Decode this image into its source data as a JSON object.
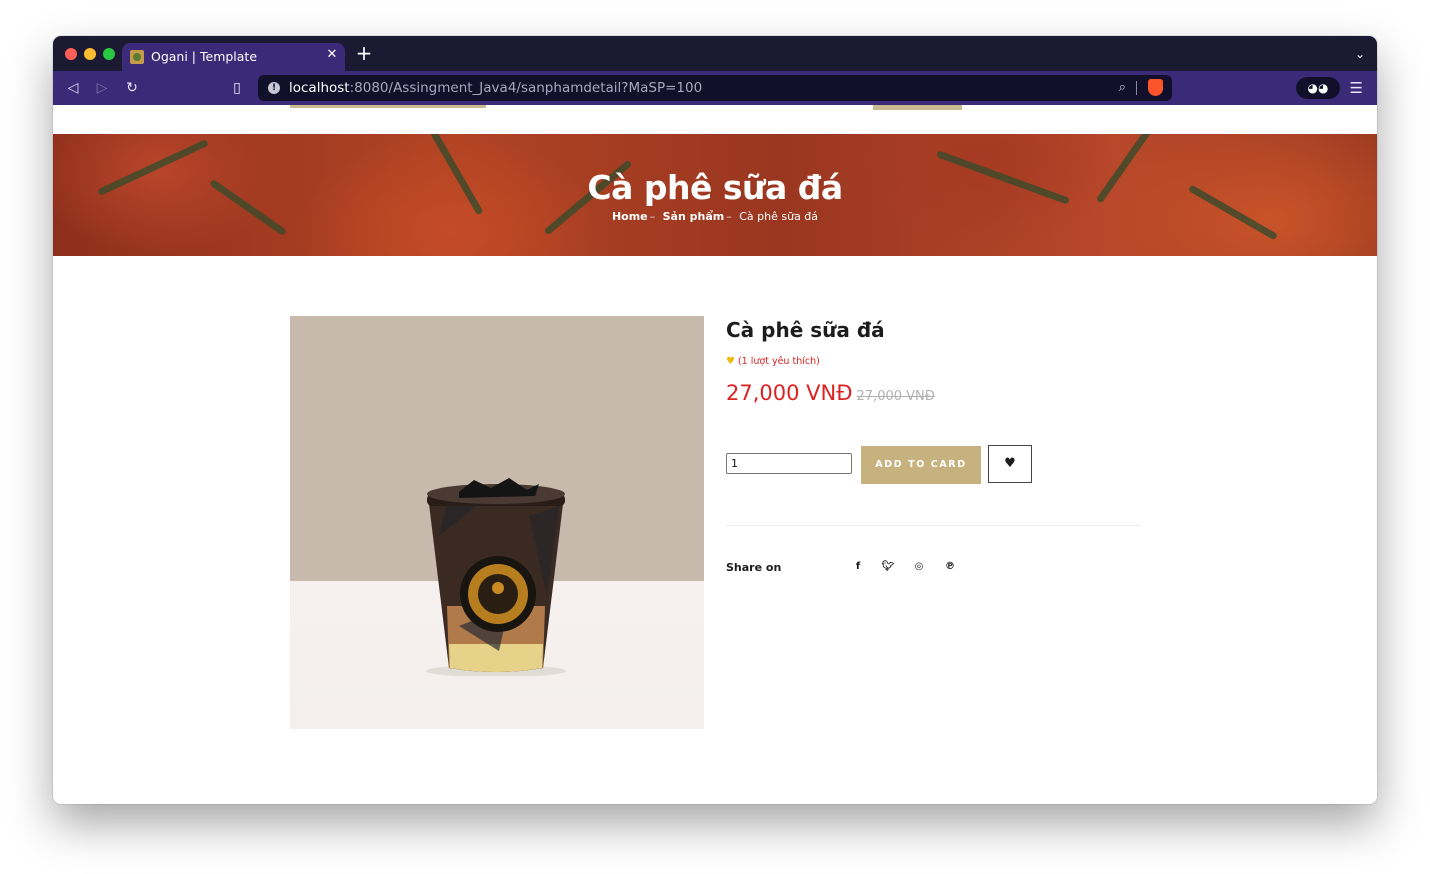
{
  "browser": {
    "tab_title": "Ogani | Template",
    "url_host": "localhost",
    "url_rest": ":8080/Assingment_Java4/sanphamdetail?MaSP=100"
  },
  "banner": {
    "title": "Cà phê sữa đá",
    "breadcrumb_home": "Home",
    "breadcrumb_products": "Sản phẩm",
    "breadcrumb_current": "Cà phê sữa đá"
  },
  "product": {
    "name": "Cà phê sữa đá",
    "likes_text": "(1 lượt yêu thích)",
    "price": "27,000 VNĐ",
    "old_price": "27,000 VNĐ",
    "quantity": "1",
    "add_to_cart_label": "ADD TO CARD",
    "share_label": "Share on"
  },
  "colors": {
    "accent": "#c7b27f",
    "price": "#dd2222",
    "browser_bar": "#3b2a78"
  }
}
